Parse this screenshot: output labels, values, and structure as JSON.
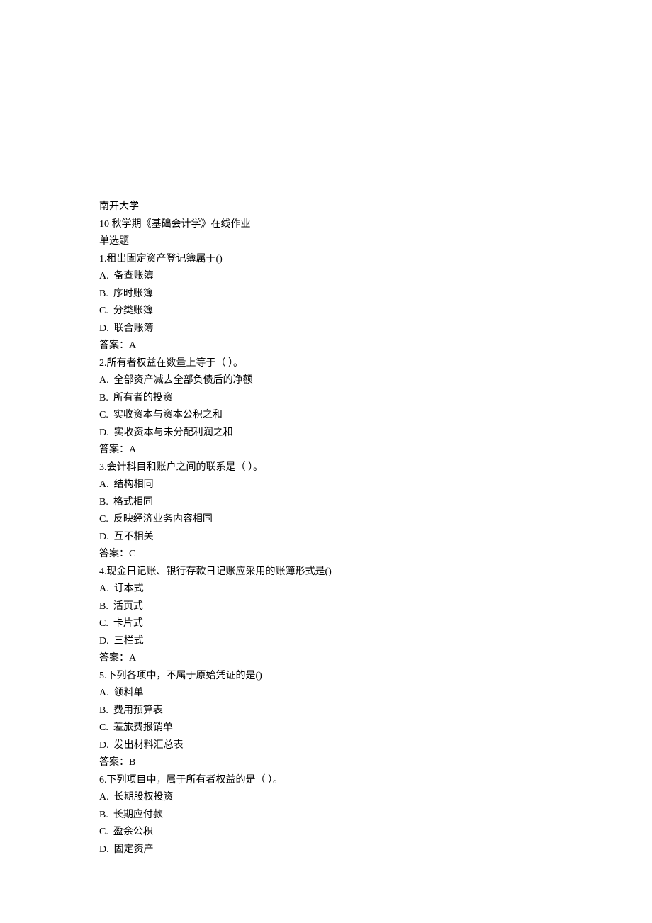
{
  "header": {
    "university": "南开大学",
    "course": "10 秋学期《基础会计学》在线作业",
    "section": "单选题"
  },
  "questions": [
    {
      "num": "1",
      "text": "租出固定资产登记簿属于()",
      "options": [
        {
          "label": "A",
          "text": "备查账簿"
        },
        {
          "label": "B",
          "text": "序时账簿"
        },
        {
          "label": "C",
          "text": "分类账簿"
        },
        {
          "label": "D",
          "text": "联合账簿"
        }
      ],
      "answer_label": "答案：",
      "answer": "A"
    },
    {
      "num": "2",
      "text": "所有者权益在数量上等于（ ）。",
      "options": [
        {
          "label": "A",
          "text": "全部资产减去全部负债后的净额"
        },
        {
          "label": "B",
          "text": "所有者的投资"
        },
        {
          "label": "C",
          "text": "实收资本与资本公积之和"
        },
        {
          "label": "D",
          "text": "实收资本与未分配利润之和"
        }
      ],
      "answer_label": "答案：",
      "answer": "A"
    },
    {
      "num": "3",
      "text": "会计科目和账户之间的联系是（ ）。",
      "options": [
        {
          "label": "A",
          "text": "结构相同"
        },
        {
          "label": "B",
          "text": "格式相同"
        },
        {
          "label": "C",
          "text": "反映经济业务内容相同"
        },
        {
          "label": "D",
          "text": "互不相关"
        }
      ],
      "answer_label": "答案：",
      "answer": "C"
    },
    {
      "num": "4",
      "text": "现金日记账、银行存款日记账应采用的账簿形式是()",
      "options": [
        {
          "label": "A",
          "text": "订本式"
        },
        {
          "label": "B",
          "text": "活页式"
        },
        {
          "label": "C",
          "text": "卡片式"
        },
        {
          "label": "D",
          "text": "三栏式"
        }
      ],
      "answer_label": "答案：",
      "answer": "A"
    },
    {
      "num": "5",
      "text": "下列各项中，不属于原始凭证的是()",
      "options": [
        {
          "label": "A",
          "text": "领料单"
        },
        {
          "label": "B",
          "text": "费用预算表"
        },
        {
          "label": "C",
          "text": "差旅费报销单"
        },
        {
          "label": "D",
          "text": "发出材料汇总表"
        }
      ],
      "answer_label": "答案：",
      "answer": "B"
    },
    {
      "num": "6",
      "text": "下列项目中，属于所有者权益的是（ ）。",
      "options": [
        {
          "label": "A",
          "text": "长期股权投资"
        },
        {
          "label": "B",
          "text": "长期应付款"
        },
        {
          "label": "C",
          "text": "盈余公积"
        },
        {
          "label": "D",
          "text": "固定资产"
        }
      ],
      "answer_label": "",
      "answer": ""
    }
  ]
}
